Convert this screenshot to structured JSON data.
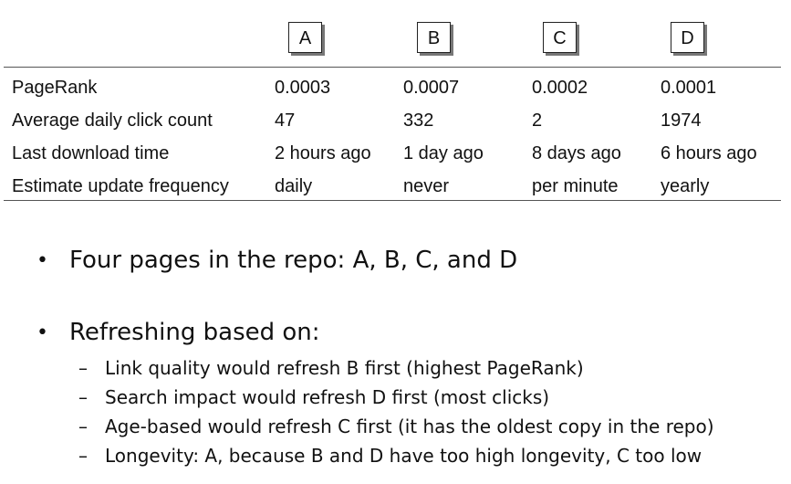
{
  "table": {
    "pages": [
      "A",
      "B",
      "C",
      "D"
    ],
    "rows": [
      {
        "label": "PageRank",
        "values": [
          "0.0003",
          "0.0007",
          "0.0002",
          "0.0001"
        ]
      },
      {
        "label": "Average daily click count",
        "values": [
          "47",
          "332",
          "2",
          "1974"
        ]
      },
      {
        "label": "Last download time",
        "values": [
          "2 hours ago",
          "1 day ago",
          "8 days ago",
          "6 hours ago"
        ]
      },
      {
        "label": "Estimate update frequency",
        "values": [
          "daily",
          "never",
          "per minute",
          "yearly"
        ]
      }
    ]
  },
  "bullets": [
    {
      "text": "Four pages in the repo: A, B, C, and D",
      "subs": []
    },
    {
      "text": "Refreshing based on:",
      "subs": [
        "Link quality would refresh B first (highest PageRank)",
        "Search impact would refresh D first (most clicks)",
        "Age-based would refresh C first (it has the oldest copy in the repo)",
        "Longevity: A, because B and D have too high longevity, C too low"
      ]
    }
  ],
  "symbols": {
    "bullet": "•",
    "dash": "–"
  }
}
